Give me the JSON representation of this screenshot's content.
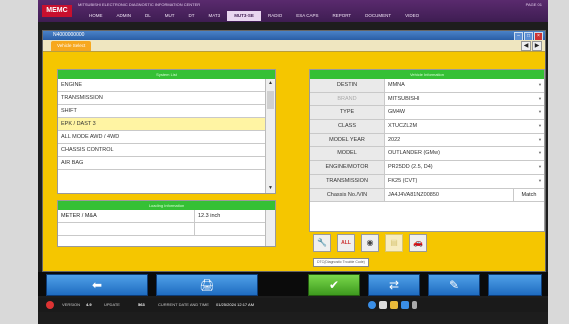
{
  "topbar": {
    "logo": "MEMC",
    "title": "MITSUBISHI ELECTRONIC DIAGNOSTIC INFORMATION CENTER",
    "right_label": "PAGE 01",
    "menu": [
      "HOME",
      "ADMIN",
      "DL",
      "MUT",
      "DT",
      "MAT3",
      "MUT3-SE",
      "RADIO",
      "ESA CAPS",
      "REPORT",
      "DOCUMENT",
      "VIDEO"
    ],
    "active_menu": "MUT3-SE"
  },
  "window": {
    "title": "N4000000000",
    "tab": "Vehicle Select",
    "nav_prev": "◀",
    "nav_next": "▶"
  },
  "system_panel": {
    "header": "System List",
    "items": [
      "ENGINE",
      "TRANSMISSION",
      "SHIFT",
      "EPK / DAST 3",
      "ALL MODE AWD / 4WD",
      "CHASSIS CONTROL",
      "AIR BAG"
    ],
    "selected_index": 3
  },
  "param_panel": {
    "header": "Loading Information",
    "rows": [
      {
        "name": "METER / M&A",
        "value": "12.3 inch"
      },
      {
        "name": "",
        "value": ""
      }
    ]
  },
  "info_panel": {
    "header": "Vehicle Information",
    "rows": [
      {
        "label": "DESTIN",
        "value": "MMNA",
        "dim": false
      },
      {
        "label": "BRAND",
        "value": "MITSUBISHI",
        "dim": true
      },
      {
        "label": "TYPE",
        "value": "GM4W",
        "dim": false
      },
      {
        "label": "CLASS",
        "value": "XTUCZL2M",
        "dim": false
      },
      {
        "label": "MODEL YEAR",
        "value": "2022",
        "dim": false
      },
      {
        "label": "MODEL",
        "value": "OUTLANDER (GMw)",
        "dim": false
      },
      {
        "label": "ENGINE/MOTOR",
        "value": "PR25DD (2.5, D4)",
        "dim": false
      },
      {
        "label": "TRANSMISSION",
        "value": "FK25 (CVT)",
        "dim": false
      },
      {
        "label": "Chassis No./VIN",
        "value": "JA4J4VA81NZ00850",
        "dim": false
      }
    ],
    "match_label": "Match"
  },
  "tools": [
    {
      "name": "vehicle-tool-icon",
      "glyph": "🔧"
    },
    {
      "name": "all-dtc-icon",
      "glyph": "ALL"
    },
    {
      "name": "record-icon",
      "glyph": "◉"
    },
    {
      "name": "disabled-tool-icon",
      "glyph": "▤"
    },
    {
      "name": "car-info-icon",
      "glyph": "🚗"
    }
  ],
  "tooltip": "DTC(Diagnostic Trouble Code)",
  "bottom_buttons": [
    {
      "name": "back-button",
      "glyph": "⬅"
    },
    {
      "name": "print-button",
      "glyph": "🖨"
    },
    {
      "name": "ok-button",
      "glyph": "✔"
    },
    {
      "name": "compare-button",
      "glyph": "⇄"
    },
    {
      "name": "erase-button",
      "glyph": "✎"
    }
  ],
  "statusbar": {
    "version_label": "VERSION",
    "version": "4.9",
    "update_label": "UPDATE",
    "update": "563",
    "current_date_label": "CURRENT DATE AND TIME",
    "current_date": "01/25/2024 12:17 AM"
  },
  "colors": {
    "menu_bg": "#3e1d52",
    "content_bg": "#f5c600",
    "panel_header": "#35c035",
    "button_blue": "#1f6cc0",
    "button_green": "#3e9a1e"
  }
}
